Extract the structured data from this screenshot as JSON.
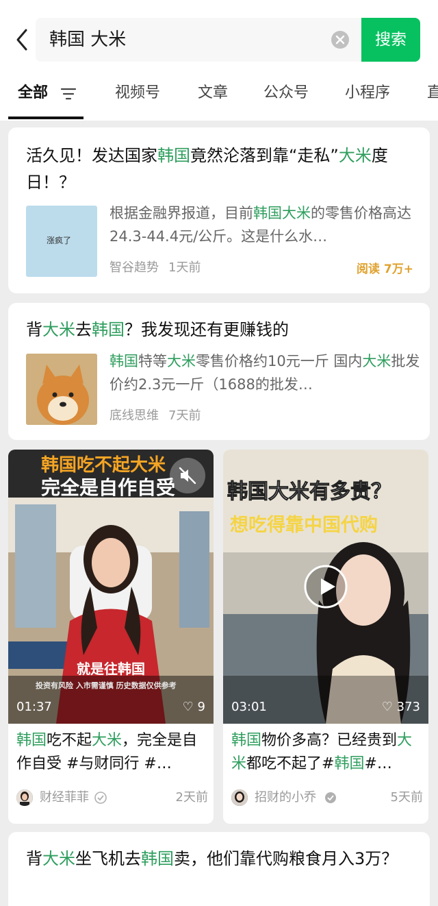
{
  "search": {
    "query": "韩国 大米",
    "button_label": "搜索"
  },
  "tabs": [
    {
      "label": "全部",
      "active": true
    },
    {
      "label": "视频号"
    },
    {
      "label": "文章"
    },
    {
      "label": "公众号"
    },
    {
      "label": "小程序"
    },
    {
      "label": "直"
    }
  ],
  "articles": [
    {
      "title_parts": [
        "活久见！发达国家",
        "韩国",
        "竟然沦落到靠“走私”",
        "大米",
        "度日！？"
      ],
      "snippet_parts": [
        "根据金融界报道，目前",
        "韩国大米",
        "的零售价格高达24.3-44.4元/公斤。这是什么水…"
      ],
      "thumb_text": "涨疯了",
      "source": "智谷趋势",
      "time": "1天前",
      "reads": "阅读 7万+"
    },
    {
      "title_parts": [
        "背",
        "大米",
        "去",
        "韩国",
        "？我发现还有更赚钱的"
      ],
      "snippet_parts": [
        "韩国",
        "特等",
        "大米",
        "零售价格约10元一斤 国内",
        "大米",
        "批发价约2.3元一斤（1688的批发…"
      ],
      "source": "底线思维",
      "time": "7天前"
    }
  ],
  "videos": [
    {
      "overlay_line1": "韩国吃不起大米",
      "overlay_line2": "完全是自作自受",
      "caption": "就是往韩国",
      "disclaimer": "投资有风险 入市需谨慎 历史数据仅供参考",
      "duration": "01:37",
      "likes": "9",
      "title_parts": [
        "韩国",
        "吃不起",
        "大米",
        "，完全是自作自受 #与财同行 #…"
      ],
      "author": "财经菲菲",
      "time": "2天前"
    },
    {
      "overlay_line1": "韩国大米有多贵？",
      "overlay_line2": "想吃得靠中国代购",
      "duration": "03:01",
      "likes": "373",
      "title_parts": [
        "韩国",
        "物价多高？已经贵到",
        "大米",
        "都吃不起了#",
        "韩国",
        "#…"
      ],
      "author": "招财的小乔",
      "time": "5天前"
    }
  ],
  "bottom_article": {
    "title_parts": [
      "背",
      "大米",
      "坐飞机去",
      "韩国",
      "卖，他们靠代购粮食月入3万？"
    ]
  },
  "colors": {
    "accent": "#07c160",
    "highlight": "#2f9e5e",
    "reads": "#e0a22f"
  }
}
